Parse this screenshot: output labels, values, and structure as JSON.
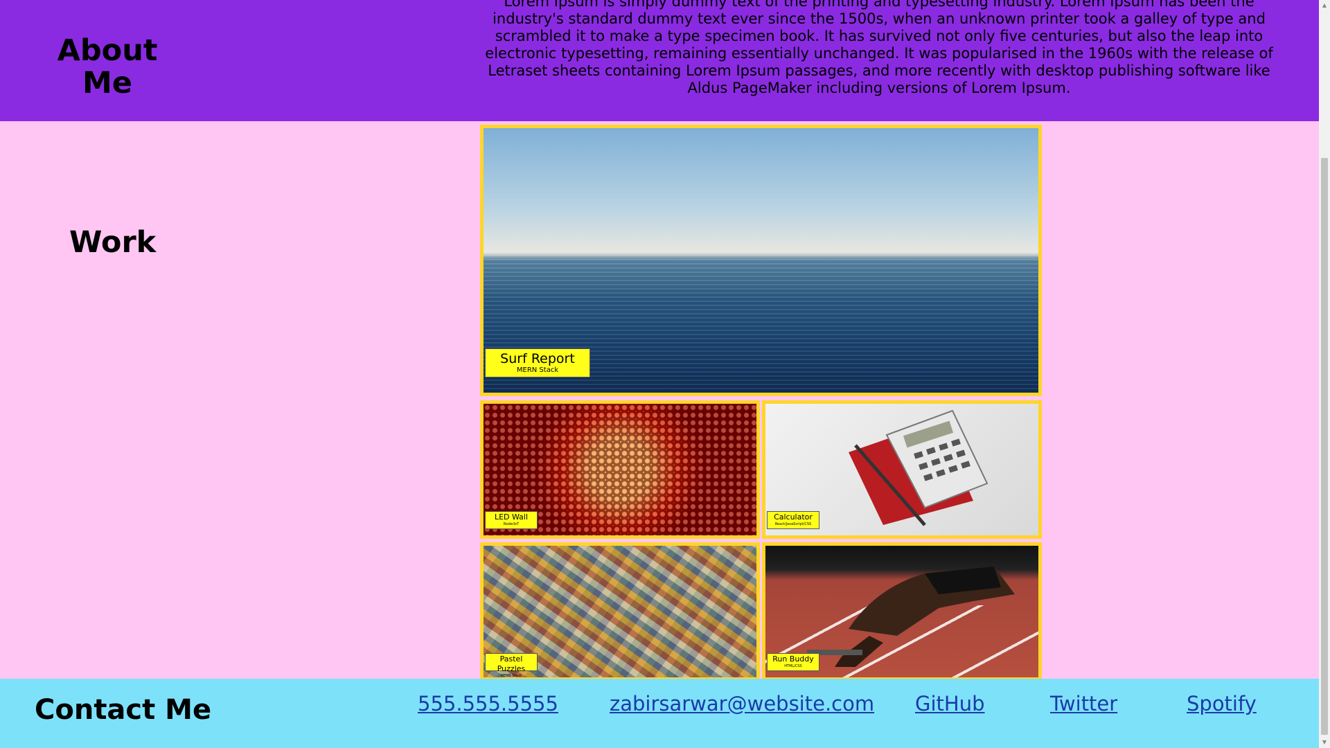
{
  "about": {
    "heading": "About Me",
    "text": "Lorem Ipsum is simply dummy text of the printing and typesetting industry. Lorem Ipsum has been the industry's standard dummy text ever since the 1500s, when an unknown printer took a galley of type and scrambled it to make a type specimen book. It has survived not only five centuries, but also the leap into electronic typesetting, remaining essentially unchanged. It was popularised in the 1960s with the release of Letraset sheets containing Lorem Ipsum passages, and more recently with desktop publishing software like Aldus PageMaker including versions of Lorem Ipsum."
  },
  "work": {
    "heading": "Work",
    "projects": [
      {
        "title": "Surf Report",
        "stack": "MERN Stack",
        "image": "ocean-horizon"
      },
      {
        "title": "LED Wall",
        "stack": "Node/IoT",
        "image": "red-led-panel"
      },
      {
        "title": "Calculator",
        "stack": "React/JavaScript/CSS",
        "image": "calculator-on-notebook"
      },
      {
        "title": "Pastel Puzzles",
        "stack": "MERN Stack",
        "image": "jigsaw-pieces"
      },
      {
        "title": "Run Buddy",
        "stack": "HTML/CSS",
        "image": "sprinter-start"
      }
    ]
  },
  "contact": {
    "heading": "Contact Me",
    "links": [
      {
        "label": "555.555.5555"
      },
      {
        "label": "zabirsarwar@website.com"
      },
      {
        "label": "GitHub"
      },
      {
        "label": "Twitter"
      },
      {
        "label": "Spotify"
      }
    ]
  },
  "colors": {
    "about_bg": "#8a2be2",
    "page_bg": "#ffc6f3",
    "contact_bg": "#7ee1fa",
    "card_border": "#ffd52a",
    "label_bg": "#ffff1a",
    "link": "#1a3ba8"
  }
}
